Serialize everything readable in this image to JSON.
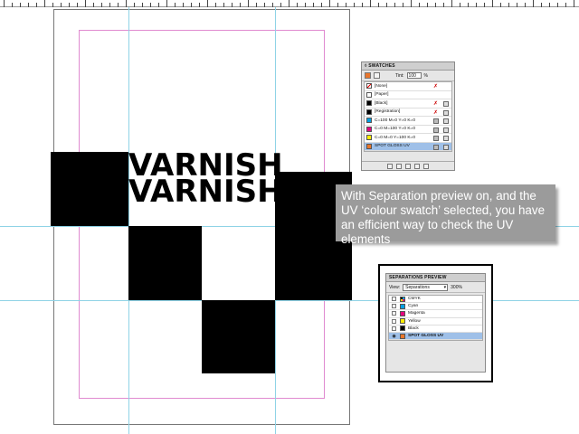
{
  "document": {
    "varnish_lines": [
      "VARNISH",
      "VARNISH"
    ]
  },
  "swatches_panel": {
    "title": "◊ SWATCHES",
    "tint_label": "Tint:",
    "tint_value": "100",
    "tint_unit": "%",
    "swatches": [
      {
        "name": "[None]",
        "color": "#ffffff"
      },
      {
        "name": "[Paper]",
        "color": "#ffffff"
      },
      {
        "name": "[Black]",
        "color": "#000000"
      },
      {
        "name": "[Registration]",
        "color": "#000000"
      },
      {
        "name": "C=100 M=0 Y=0 K=0",
        "color": "#00a0e3"
      },
      {
        "name": "C=0 M=100 Y=0 K=0",
        "color": "#e5007e"
      },
      {
        "name": "C=0 M=0 Y=100 K=0",
        "color": "#ffed00"
      },
      {
        "name": "SPOT GLOSS UV",
        "color": "#e8762d",
        "selected": true
      }
    ]
  },
  "callout": {
    "text": "With Separation preview on, and the UV ‘colour swatch’ selected, you have an efficient way to check the UV elements"
  },
  "separations_panel": {
    "title": "SEPARATIONS PREVIEW",
    "view_label": "View:",
    "view_value": "Separations",
    "zoom_value": "300%",
    "plates": [
      {
        "name": "CMYK",
        "color": "multicolor"
      },
      {
        "name": "Cyan",
        "color": "#00a0e3"
      },
      {
        "name": "Magenta",
        "color": "#e5007e"
      },
      {
        "name": "Yellow",
        "color": "#ffed00"
      },
      {
        "name": "Black",
        "color": "#000000"
      },
      {
        "name": "SPOT GLOSS UV",
        "color": "#e8762d",
        "selected": true,
        "visible": true
      }
    ]
  },
  "colors": {
    "guide": "#8fd3e6",
    "margin": "#e08ad0",
    "callout_bg": "#9b9b9b",
    "selection": "#9fc0e8"
  }
}
